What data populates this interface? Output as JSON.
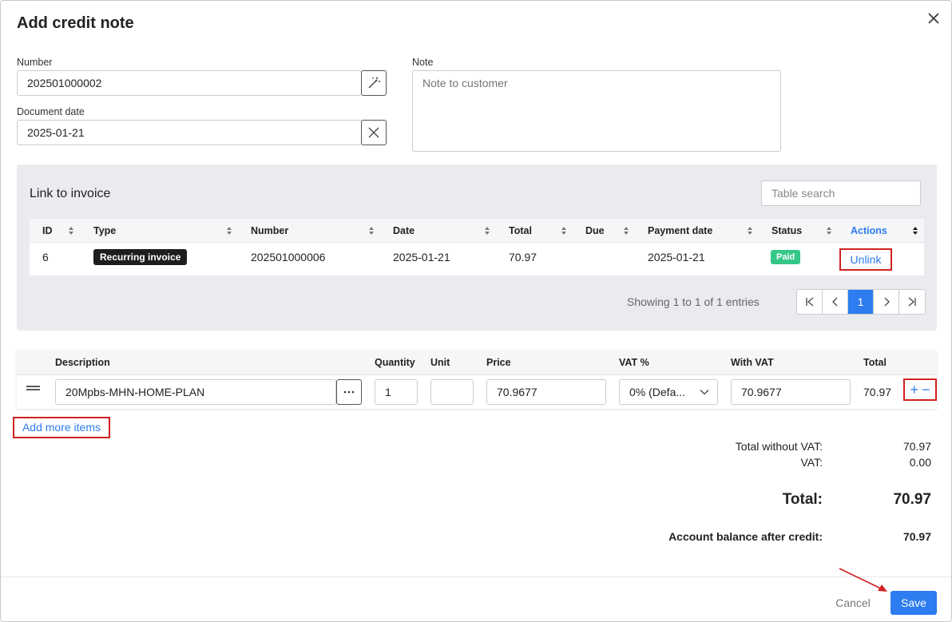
{
  "dialog": {
    "title": "Add credit note"
  },
  "form": {
    "number_label": "Number",
    "number_value": "202501000002",
    "date_label": "Document date",
    "date_value": "2025-01-21",
    "note_label": "Note",
    "note_placeholder": "Note to customer"
  },
  "link_invoice": {
    "title": "Link to invoice",
    "search_placeholder": "Table search",
    "columns": [
      "ID",
      "Type",
      "Number",
      "Date",
      "Total",
      "Due",
      "Payment date",
      "Status",
      "Actions"
    ],
    "row": {
      "id": "6",
      "type": "Recurring invoice",
      "number": "202501000006",
      "date": "2025-01-21",
      "total": "70.97",
      "due": "",
      "payment_date": "2025-01-21",
      "status": "Paid",
      "action": "Unlink"
    },
    "showing": "Showing 1 to 1 of 1 entries",
    "current_page": "1"
  },
  "items": {
    "columns": [
      "Description",
      "Quantity",
      "Unit",
      "Price",
      "VAT %",
      "With VAT",
      "Total"
    ],
    "row": {
      "description": "20Mpbs-MHN-HOME-PLAN",
      "quantity": "1",
      "unit": "",
      "price": "70.9677",
      "vat": "0% (Defa...",
      "with_vat": "70.9677",
      "total": "70.97"
    },
    "add_more": "Add more items"
  },
  "summary": {
    "total_without_vat_label": "Total without VAT:",
    "total_without_vat": "70.97",
    "vat_label": "VAT:",
    "vat": "0.00",
    "total_label": "Total:",
    "total": "70.97",
    "balance_label": "Account balance after credit:",
    "balance": "70.97"
  },
  "footer": {
    "cancel": "Cancel",
    "save": "Save"
  },
  "colors": {
    "accent": "#2d7cf0",
    "highlight": "#d0211f",
    "paid": "#35c788"
  }
}
